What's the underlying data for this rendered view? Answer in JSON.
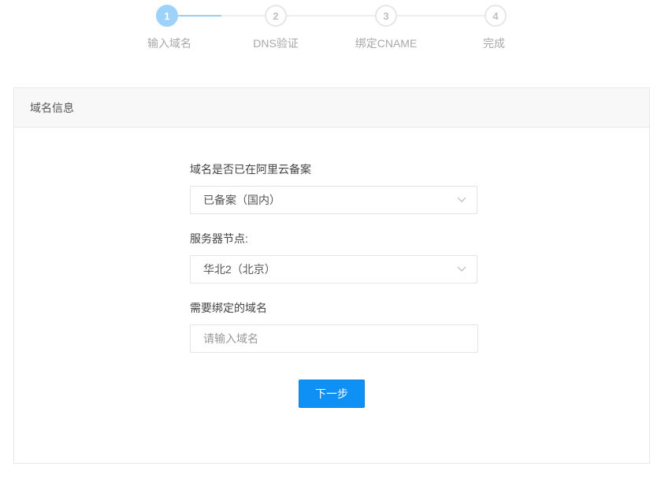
{
  "stepper": {
    "steps": [
      {
        "number": "1",
        "label": "输入域名",
        "state": "active"
      },
      {
        "number": "2",
        "label": "DNS验证",
        "state": "pending"
      },
      {
        "number": "3",
        "label": "绑定CNAME",
        "state": "pending"
      },
      {
        "number": "4",
        "label": "完成",
        "state": "pending"
      }
    ]
  },
  "card": {
    "title": "域名信息"
  },
  "form": {
    "icp_label": "域名是否已在阿里云备案",
    "icp_value": "已备案（国内）",
    "node_label": "服务器节点:",
    "node_value": "华北2（北京）",
    "domain_label": "需要绑定的域名",
    "domain_placeholder": "请输入域名",
    "domain_value": "",
    "next_label": "下一步"
  },
  "colors": {
    "accent": "#0e90f5",
    "step_active": "#9dd3fb"
  },
  "icons": {
    "select_arrow": "chevron-down-icon"
  }
}
